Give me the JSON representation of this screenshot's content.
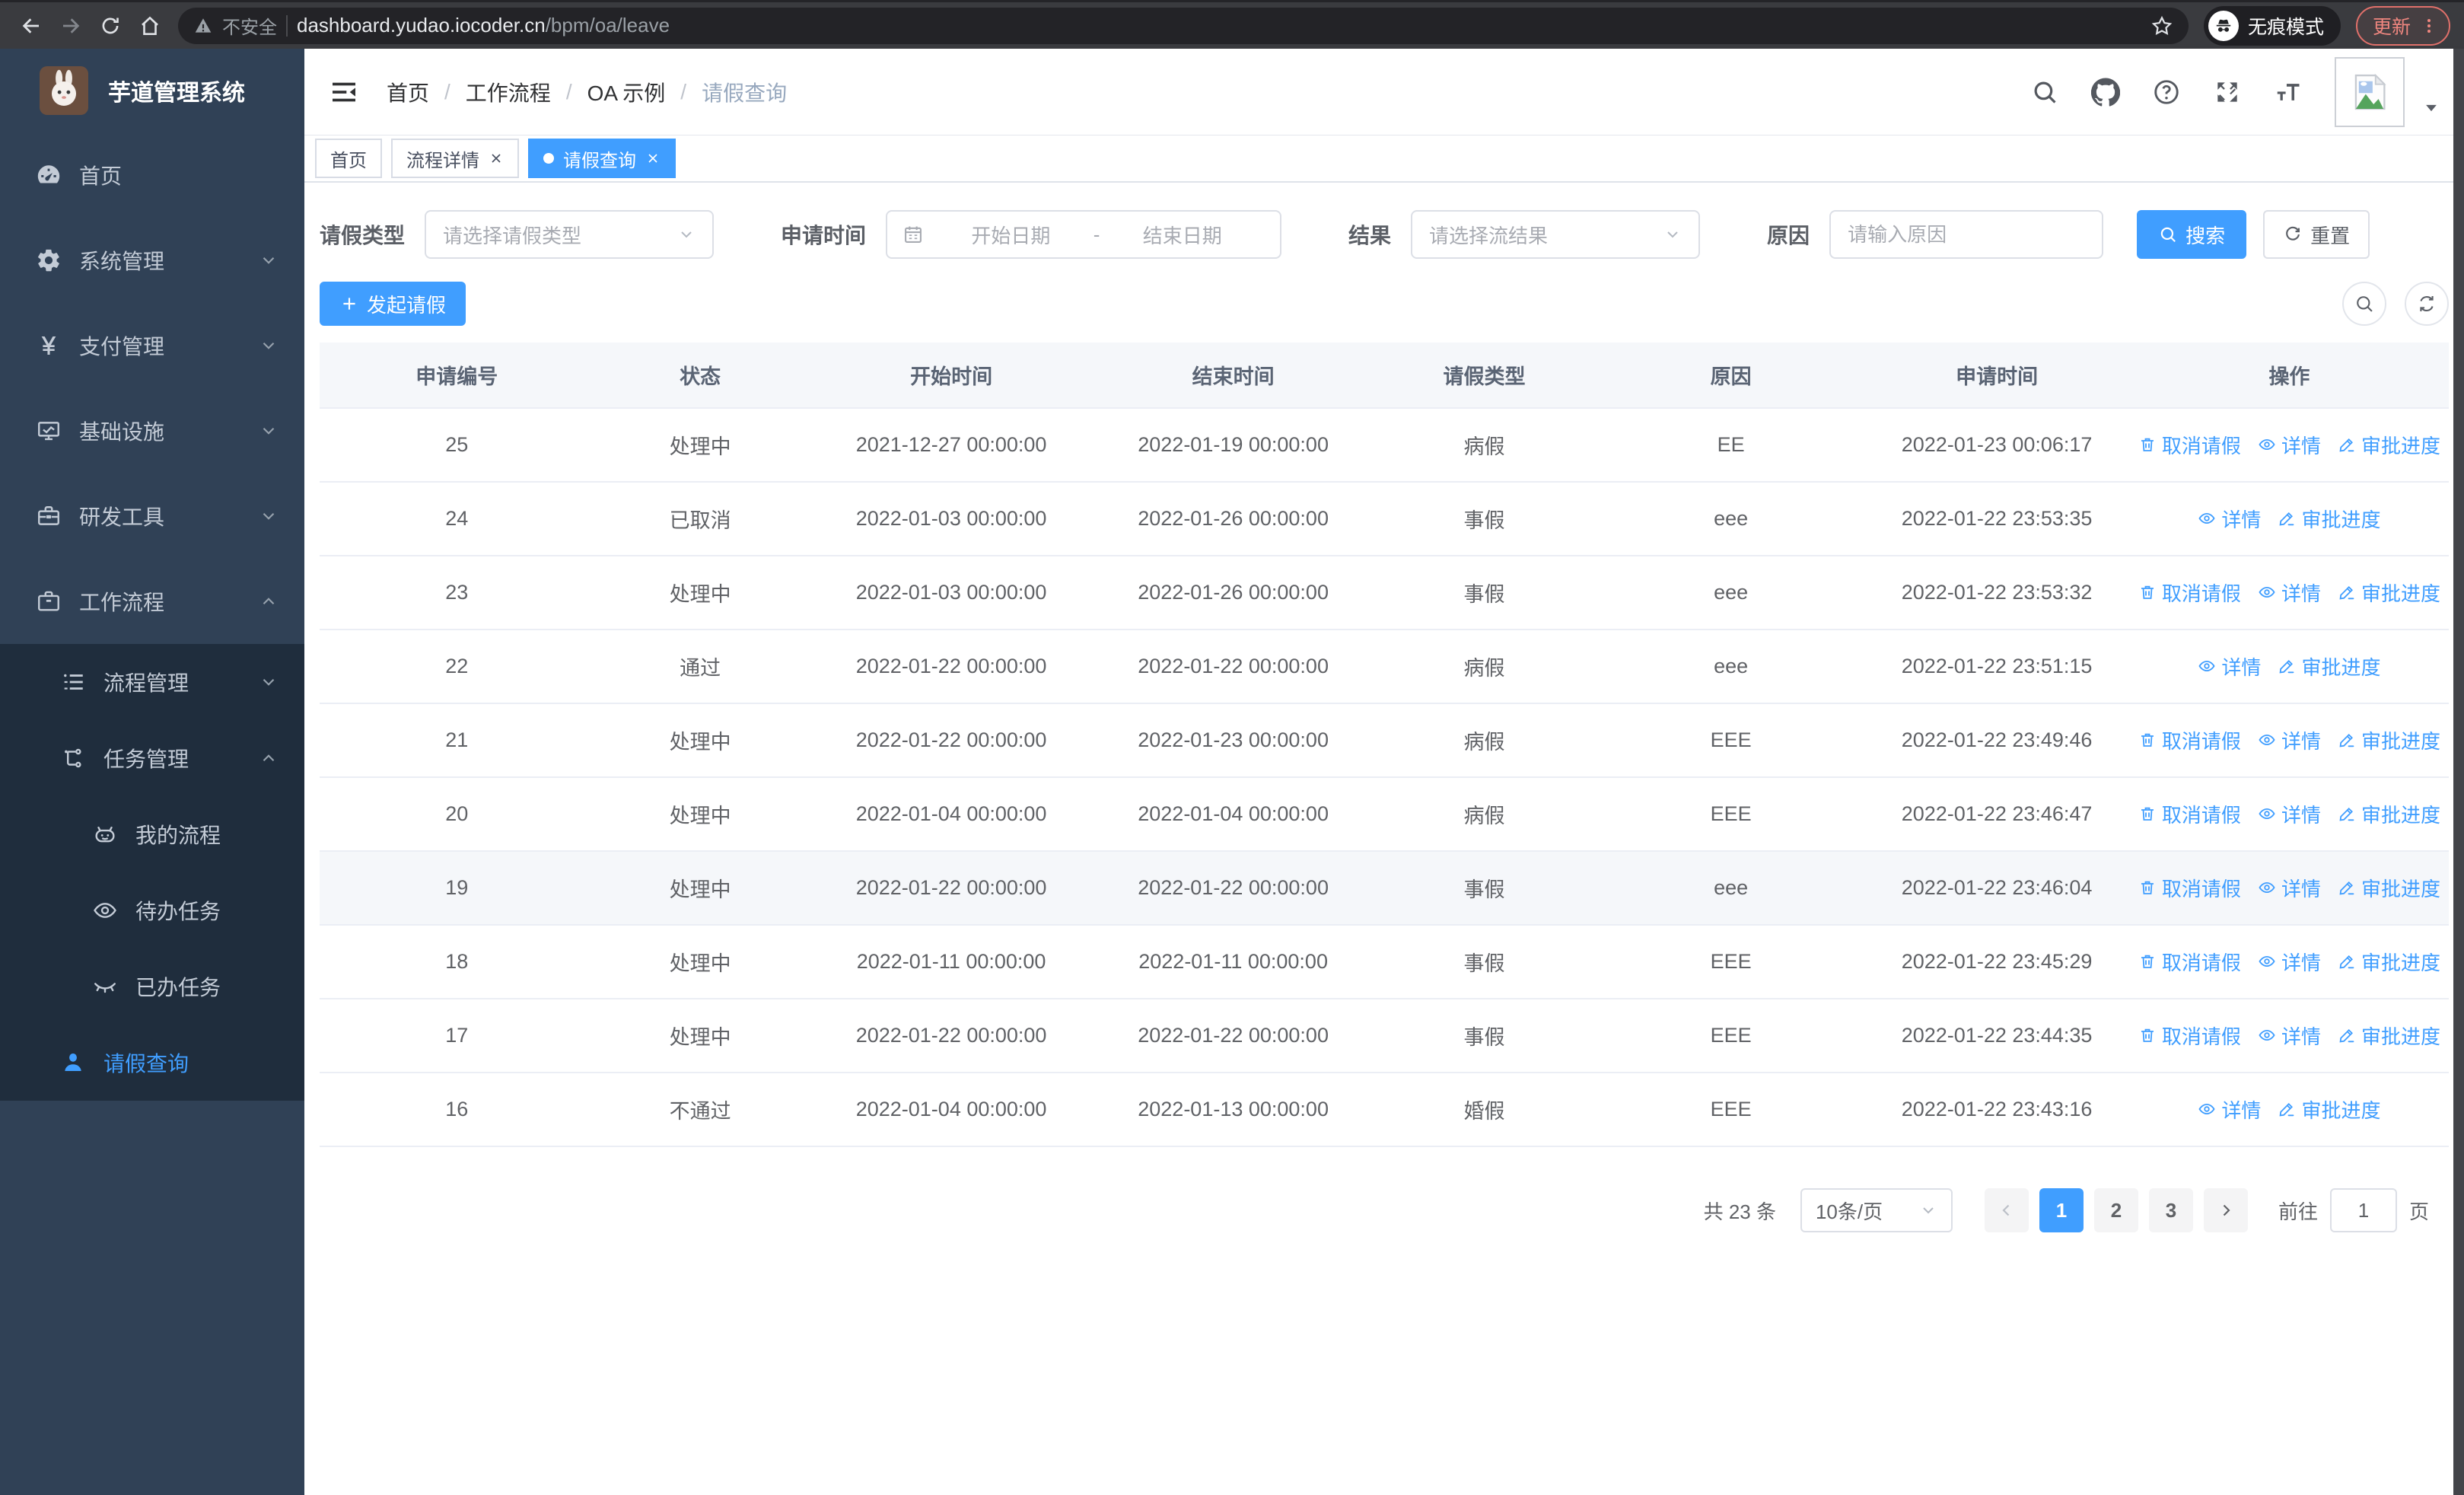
{
  "browser": {
    "security_warning": "不安全",
    "url_host": "dashboard.yudao.iocoder.cn",
    "url_path": "/bpm/oa/leave",
    "incognito_label": "无痕模式",
    "update_label": "更新"
  },
  "colors": {
    "accent": "#409eff",
    "sidebar_bg": "#304156",
    "submenu_bg": "#1f2d3d",
    "table_header_bg": "#f5f7fa",
    "update_red": "#ef867f"
  },
  "sidebar": {
    "app_title": "芋道管理系统",
    "menu": [
      {
        "name": "home",
        "label": "首页",
        "icon": "dashboard-icon",
        "level": 1,
        "chevron": ""
      },
      {
        "name": "system",
        "label": "系统管理",
        "icon": "gear-icon",
        "level": 1,
        "chevron": "down"
      },
      {
        "name": "payment",
        "label": "支付管理",
        "icon": "yen-icon",
        "level": 1,
        "chevron": "down"
      },
      {
        "name": "infra",
        "label": "基础设施",
        "icon": "monitor-icon",
        "level": 1,
        "chevron": "down"
      },
      {
        "name": "devtools",
        "label": "研发工具",
        "icon": "toolbox-icon",
        "level": 1,
        "chevron": "down"
      },
      {
        "name": "workflow",
        "label": "工作流程",
        "icon": "briefcase-icon",
        "level": 1,
        "chevron": "up"
      },
      {
        "name": "process-mgmt",
        "label": "流程管理",
        "icon": "list-icon",
        "level": 2,
        "chevron": "down"
      },
      {
        "name": "task-mgmt",
        "label": "任务管理",
        "icon": "flow-icon",
        "level": 2,
        "chevron": "up"
      },
      {
        "name": "my-process",
        "label": "我的流程",
        "icon": "robot-icon",
        "level": 3,
        "chevron": ""
      },
      {
        "name": "todo-tasks",
        "label": "待办任务",
        "icon": "eye-open-icon",
        "level": 3,
        "chevron": ""
      },
      {
        "name": "done-tasks",
        "label": "已办任务",
        "icon": "eye-closed-icon",
        "level": 3,
        "chevron": ""
      },
      {
        "name": "leave-query",
        "label": "请假查询",
        "icon": "user-icon",
        "level": 2,
        "chevron": "",
        "active": true
      }
    ]
  },
  "header": {
    "breadcrumb": [
      "首页",
      "工作流程",
      "OA 示例",
      "请假查询"
    ],
    "right_icons": [
      "search-icon",
      "github-icon",
      "help-icon",
      "fullscreen-icon",
      "font-size-icon"
    ]
  },
  "tabs": [
    {
      "name": "home",
      "label": "首页",
      "closable": false,
      "active": false
    },
    {
      "name": "process-detail",
      "label": "流程详情",
      "closable": true,
      "active": false
    },
    {
      "name": "leave-query",
      "label": "请假查询",
      "closable": true,
      "active": true
    }
  ],
  "filters": {
    "leave_type_label": "请假类型",
    "leave_type_placeholder": "请选择请假类型",
    "apply_time_label": "申请时间",
    "start_date_placeholder": "开始日期",
    "date_separator": "-",
    "end_date_placeholder": "结束日期",
    "result_label": "结果",
    "result_placeholder": "请选择流结果",
    "reason_label": "原因",
    "reason_placeholder": "请输入原因",
    "search_label": "搜索",
    "reset_label": "重置"
  },
  "toolbar": {
    "create_label": "发起请假"
  },
  "table": {
    "columns": [
      "申请编号",
      "状态",
      "开始时间",
      "结束时间",
      "请假类型",
      "原因",
      "申请时间",
      "操作"
    ],
    "action_defs": {
      "cancel": {
        "label": "取消请假",
        "icon": "trash-icon"
      },
      "detail": {
        "label": "详情",
        "icon": "eye-icon"
      },
      "progress": {
        "label": "审批进度",
        "icon": "edit-icon"
      }
    },
    "rows": [
      {
        "id": "25",
        "status": "处理中",
        "start": "2021-12-27 00:00:00",
        "end": "2022-01-19 00:00:00",
        "type": "病假",
        "reason": "EE",
        "applied": "2022-01-23 00:06:17",
        "actions": [
          "cancel",
          "detail",
          "progress"
        ],
        "highlighted": false
      },
      {
        "id": "24",
        "status": "已取消",
        "start": "2022-01-03 00:00:00",
        "end": "2022-01-26 00:00:00",
        "type": "事假",
        "reason": "eee",
        "applied": "2022-01-22 23:53:35",
        "actions": [
          "detail",
          "progress"
        ],
        "highlighted": false
      },
      {
        "id": "23",
        "status": "处理中",
        "start": "2022-01-03 00:00:00",
        "end": "2022-01-26 00:00:00",
        "type": "事假",
        "reason": "eee",
        "applied": "2022-01-22 23:53:32",
        "actions": [
          "cancel",
          "detail",
          "progress"
        ],
        "highlighted": false
      },
      {
        "id": "22",
        "status": "通过",
        "start": "2022-01-22 00:00:00",
        "end": "2022-01-22 00:00:00",
        "type": "病假",
        "reason": "eee",
        "applied": "2022-01-22 23:51:15",
        "actions": [
          "detail",
          "progress"
        ],
        "highlighted": false
      },
      {
        "id": "21",
        "status": "处理中",
        "start": "2022-01-22 00:00:00",
        "end": "2022-01-23 00:00:00",
        "type": "病假",
        "reason": "EEE",
        "applied": "2022-01-22 23:49:46",
        "actions": [
          "cancel",
          "detail",
          "progress"
        ],
        "highlighted": false
      },
      {
        "id": "20",
        "status": "处理中",
        "start": "2022-01-04 00:00:00",
        "end": "2022-01-04 00:00:00",
        "type": "病假",
        "reason": "EEE",
        "applied": "2022-01-22 23:46:47",
        "actions": [
          "cancel",
          "detail",
          "progress"
        ],
        "highlighted": false
      },
      {
        "id": "19",
        "status": "处理中",
        "start": "2022-01-22 00:00:00",
        "end": "2022-01-22 00:00:00",
        "type": "事假",
        "reason": "eee",
        "applied": "2022-01-22 23:46:04",
        "actions": [
          "cancel",
          "detail",
          "progress"
        ],
        "highlighted": true
      },
      {
        "id": "18",
        "status": "处理中",
        "start": "2022-01-11 00:00:00",
        "end": "2022-01-11 00:00:00",
        "type": "事假",
        "reason": "EEE",
        "applied": "2022-01-22 23:45:29",
        "actions": [
          "cancel",
          "detail",
          "progress"
        ],
        "highlighted": false
      },
      {
        "id": "17",
        "status": "处理中",
        "start": "2022-01-22 00:00:00",
        "end": "2022-01-22 00:00:00",
        "type": "事假",
        "reason": "EEE",
        "applied": "2022-01-22 23:44:35",
        "actions": [
          "cancel",
          "detail",
          "progress"
        ],
        "highlighted": false
      },
      {
        "id": "16",
        "status": "不通过",
        "start": "2022-01-04 00:00:00",
        "end": "2022-01-13 00:00:00",
        "type": "婚假",
        "reason": "EEE",
        "applied": "2022-01-22 23:43:16",
        "actions": [
          "detail",
          "progress"
        ],
        "highlighted": false
      }
    ]
  },
  "pagination": {
    "total_label": "共 23 条",
    "page_size": "10条/页",
    "pages": [
      "1",
      "2",
      "3"
    ],
    "active_page": "1",
    "goto_label": "前往",
    "goto_value": "1",
    "page_suffix_label": "页"
  }
}
